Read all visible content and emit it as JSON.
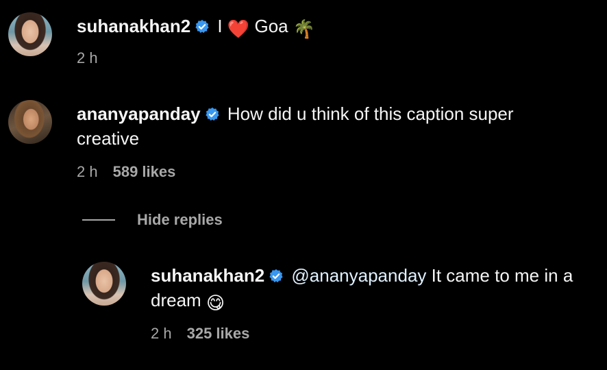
{
  "comments": [
    {
      "username": "suhanakhan2",
      "text_before": "I",
      "emoji": "❤️",
      "text_after": "Goa",
      "emoji2": "🌴",
      "time": "2 h"
    },
    {
      "username": "ananyapanday",
      "text": "How did u think of this caption super",
      "text_cont": "creative",
      "time": "2 h",
      "likes": "589 likes"
    }
  ],
  "hide_replies_label": "Hide replies",
  "reply": {
    "username": "suhanakhan2",
    "mention": "@ananyapanday",
    "text": "It came to me in a",
    "text_cont": "dream",
    "emoji": "😋",
    "time": "2 h",
    "likes": "325 likes"
  },
  "icons": {
    "verified": "verified-badge-icon",
    "verified_color": "#3897f0"
  }
}
